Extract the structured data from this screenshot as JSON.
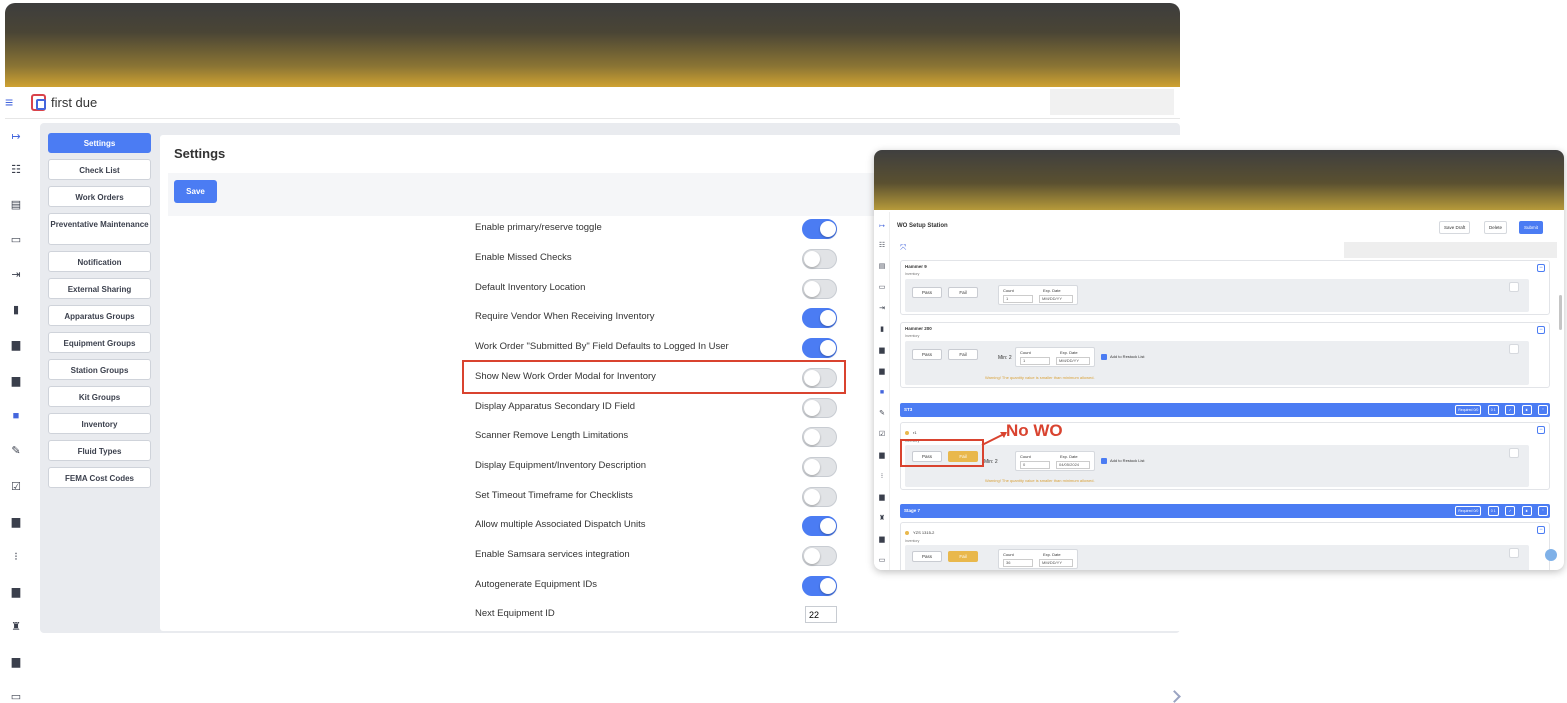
{
  "brand": {
    "name": "first due"
  },
  "settings_nav": [
    {
      "label": "Settings",
      "active": true
    },
    {
      "label": "Check List"
    },
    {
      "label": "Work Orders"
    },
    {
      "label": "Preventative Maintenance"
    },
    {
      "label": "Notification"
    },
    {
      "label": "External Sharing"
    },
    {
      "label": "Apparatus Groups"
    },
    {
      "label": "Equipment Groups"
    },
    {
      "label": "Station Groups"
    },
    {
      "label": "Kit Groups"
    },
    {
      "label": "Inventory"
    },
    {
      "label": "Fluid Types"
    },
    {
      "label": "FEMA Cost Codes"
    }
  ],
  "page": {
    "title": "Settings",
    "save_label": "Save"
  },
  "settings": [
    {
      "label": "Enable primary/reserve toggle",
      "on": true
    },
    {
      "label": "Enable Missed Checks",
      "on": false
    },
    {
      "label": "Default Inventory Location",
      "on": false
    },
    {
      "label": "Require Vendor When Receiving Inventory",
      "on": true
    },
    {
      "label": "Work Order \"Submitted By\" Field Defaults to Logged In User",
      "on": true
    },
    {
      "label": "Show New Work Order Modal for Inventory",
      "on": false
    },
    {
      "label": "Display Apparatus Secondary ID Field",
      "on": false
    },
    {
      "label": "Scanner Remove Length Limitations",
      "on": false
    },
    {
      "label": "Display Equipment/Inventory Description",
      "on": false
    },
    {
      "label": "Set Timeout Timeframe for Checklists",
      "on": false
    },
    {
      "label": "Allow multiple Associated Dispatch Units",
      "on": true
    },
    {
      "label": "Enable Samsara services integration",
      "on": false
    },
    {
      "label": "Autogenerate Equipment IDs",
      "on": true
    },
    {
      "label": "Next Equipment ID",
      "value": "22"
    }
  ],
  "colors": {
    "accent": "#4b7cf3",
    "highlight": "#d9432f",
    "warning": "#e9b84c"
  },
  "overlay": {
    "title": "WO Setup Station",
    "buttons": {
      "save_draft": "Save Draft",
      "delete": "Delete",
      "submit": "Submit"
    },
    "cards": [
      {
        "name": "Hammer 9",
        "sub": "Inventory",
        "pass": "Pass",
        "fail": "Fail",
        "count_label": "Count",
        "count": "1",
        "exp_label": "Exp. Date",
        "exp": "MM/DD/YY"
      },
      {
        "name": "Hammer 200",
        "sub": "Inventory",
        "pass": "Pass",
        "fail": "Fail",
        "min": "Min: 2",
        "count_label": "Count",
        "count": "1",
        "exp_label": "Exp. Date",
        "exp": "MM/DD/YY",
        "restock": "Add to Restock List",
        "warning": "Warning! The quantity value is smaller than minimum allowed."
      }
    ],
    "group_st3": {
      "title": "ST3",
      "required": "Required 0/0",
      "count": "0 1"
    },
    "st3_item": {
      "name": "r1",
      "sub": "Inventory",
      "pass": "Pass",
      "fail": "Fail",
      "min": "Min: 2",
      "count_label": "Count",
      "count": "0",
      "exp_label": "Exp. Date",
      "exp": "04/05/2024",
      "restock": "Add to Restock List",
      "warning": "Warning! The quantity value is smaller than minimum allowed."
    },
    "group_stage7": {
      "title": "Stage 7",
      "required": "Required 0/0",
      "count": "0 1"
    },
    "stage7_item": {
      "name": "YZS 1315-2",
      "sub": "Inventory",
      "pass": "Pass",
      "fail": "Fail",
      "count_label": "Count",
      "count": "36",
      "exp_label": "Exp. Date",
      "exp": "MM/DD/YY"
    }
  },
  "annotation": {
    "label": "No WO"
  }
}
